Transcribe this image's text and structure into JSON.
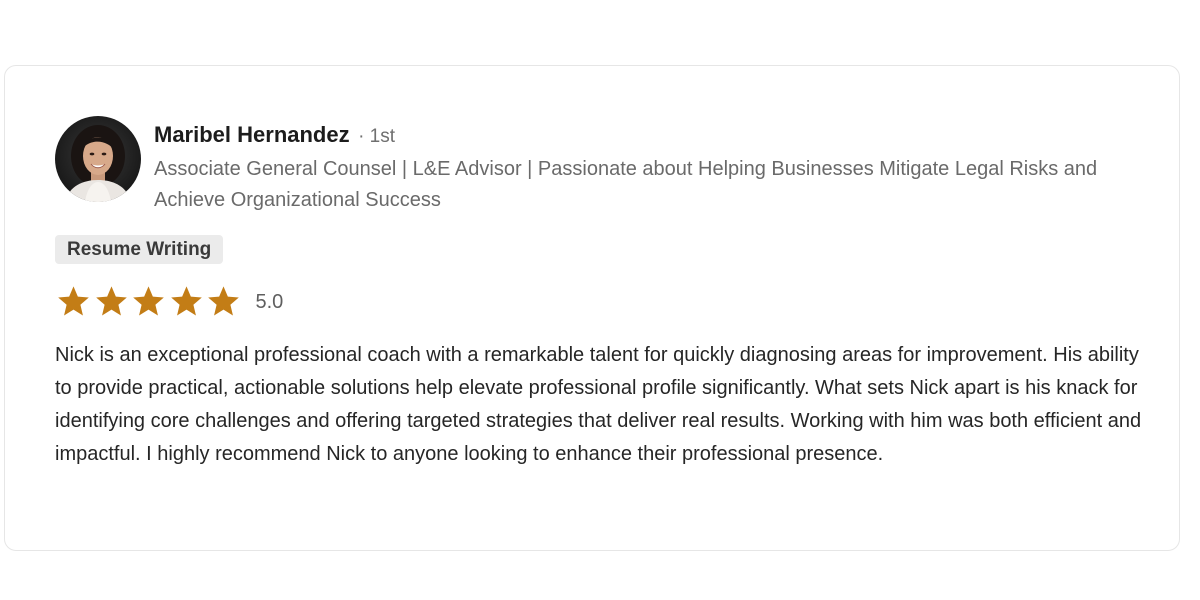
{
  "reviewer": {
    "name": "Maribel Hernandez",
    "connection_degree": "· 1st",
    "headline": "Associate General Counsel | L&E Advisor | Passionate about Helping Businesses Mitigate Legal Risks and Achieve Organizational Success"
  },
  "service_tag": "Resume Writing",
  "rating": {
    "stars_filled": 5,
    "stars_total": 5,
    "score_label": "5.0",
    "star_color": "#c37d16"
  },
  "review_text": "Nick is an exceptional professional coach with a remarkable talent for quickly diagnosing areas for improvement. His ability to provide practical, actionable solutions help elevate professional profile significantly. What sets Nick apart is his knack for identifying core challenges and offering targeted strategies that deliver real results. Working with him was both efficient and impactful. I highly recommend Nick to anyone looking to enhance their professional presence."
}
